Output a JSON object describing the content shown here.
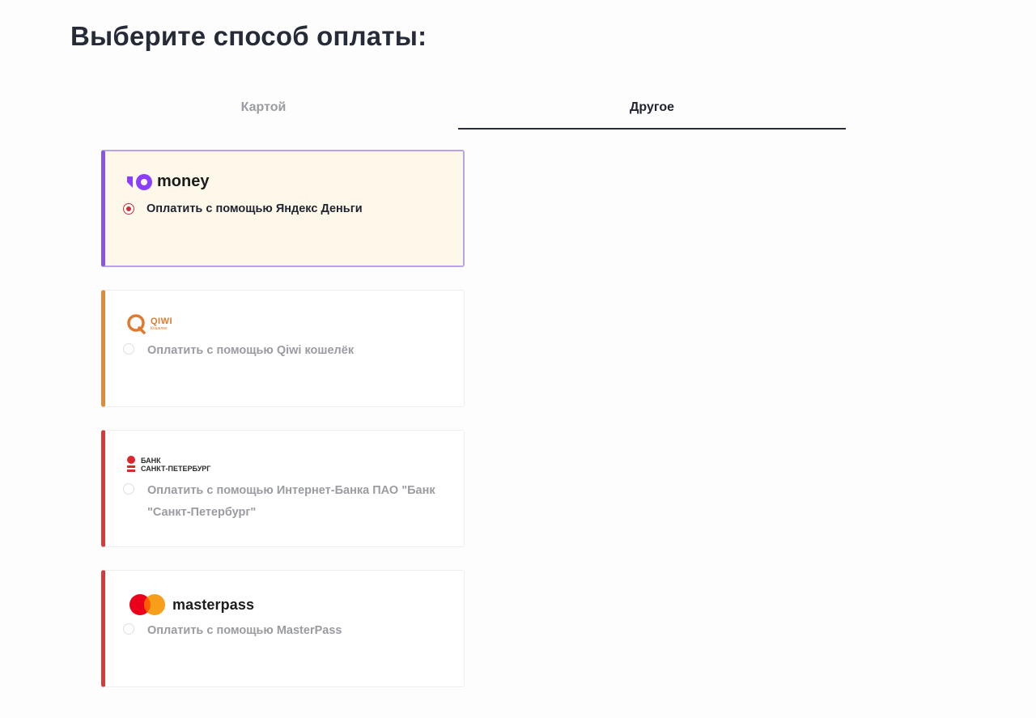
{
  "header": {
    "title": "Выберите способ оплаты:"
  },
  "tabs": [
    {
      "label": "Картой",
      "active": false
    },
    {
      "label": "Другое",
      "active": true
    }
  ],
  "options": [
    {
      "logo_text": "money",
      "logo_icon": "yoomoney-logo",
      "label": "Оплатить с помощью Яндекс Деньги",
      "selected": true,
      "accent": "#8a55e0"
    },
    {
      "logo_text": "QIWI",
      "logo_subtext": "Кошелек",
      "logo_icon": "qiwi-logo",
      "label": "Оплатить с помощью Qiwi кошелёк",
      "selected": false,
      "accent": "#e08a3c"
    },
    {
      "logo_text_line1": "БАНК",
      "logo_text_line2": "САНКТ-ПЕТЕРБУРГ",
      "logo_icon": "bank-spb-logo",
      "label": "Оплатить с помощью Интернет-Банка ПАО \"Банк \"Санкт-Петербург\"",
      "selected": false,
      "accent": "#d83a3a"
    },
    {
      "logo_text": "masterpass",
      "logo_icon": "masterpass-logo",
      "label": "Оплатить с помощью MasterPass",
      "selected": false,
      "accent": "#d83a3a"
    }
  ]
}
